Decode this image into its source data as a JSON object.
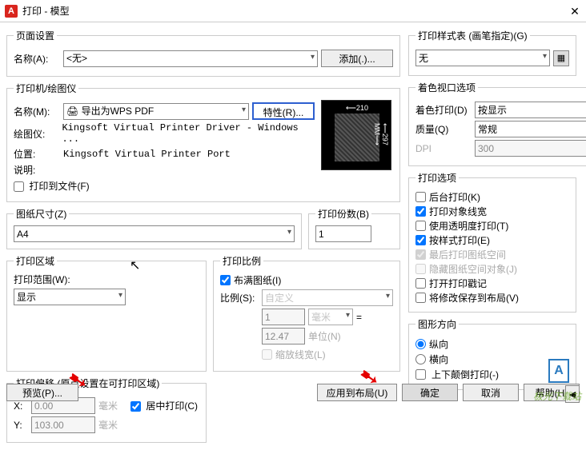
{
  "titlebar": {
    "logo": "A",
    "title": "打印 - 模型"
  },
  "pageSetup": {
    "legend": "页面设置",
    "nameLabel": "名称(A):",
    "nameValue": "<无>",
    "addBtn": "添加(.)..."
  },
  "printer": {
    "legend": "打印机/绘图仪",
    "nameLabel": "名称(M):",
    "nameValue": "导出为WPS PDF",
    "propsBtn": "特性(R)...",
    "plotterLabel": "绘图仪:",
    "plotterValue": "Kingsoft Virtual Printer Driver - Windows ...",
    "locationLabel": "位置:",
    "locationValue": "Kingsoft Virtual Printer Port",
    "descLabel": "说明:",
    "toFile": "打印到文件(F)",
    "dimTop": "⟵210 MM⟶",
    "dimRight": "⟵297 MM⟶"
  },
  "paper": {
    "legend": "图纸尺寸(Z)",
    "value": "A4"
  },
  "copies": {
    "legend": "打印份数(B)",
    "value": "1"
  },
  "area": {
    "legend": "打印区域",
    "rangeLabel": "打印范围(W):",
    "rangeValue": "显示"
  },
  "scale": {
    "legend": "打印比例",
    "fit": "布满图纸(I)",
    "ratioLabel": "比例(S):",
    "ratioValue": "自定义",
    "num": "1",
    "unit1": "毫米",
    "eq": "=",
    "den": "12.47",
    "unit2": "单位(N)",
    "lineweights": "缩放线宽(L)"
  },
  "offset": {
    "legend": "打印偏移 (原点设置在可打印区域)",
    "xLabel": "X:",
    "xVal": "0.00",
    "xUnit": "毫米",
    "yLabel": "Y:",
    "yVal": "103.00",
    "yUnit": "毫米",
    "center": "居中打印(C)"
  },
  "styleTable": {
    "legend": "打印样式表 (画笔指定)(G)",
    "value": "无"
  },
  "shaded": {
    "legend": "着色视口选项",
    "shadeLabel": "着色打印(D)",
    "shadeValue": "按显示",
    "qualityLabel": "质量(Q)",
    "qualityValue": "常规",
    "dpiLabel": "DPI",
    "dpiValue": "300"
  },
  "options": {
    "legend": "打印选项",
    "items": [
      {
        "label": "后台打印(K)",
        "checked": false,
        "disabled": false
      },
      {
        "label": "打印对象线宽",
        "checked": true,
        "disabled": false
      },
      {
        "label": "使用透明度打印(T)",
        "checked": false,
        "disabled": false
      },
      {
        "label": "按样式打印(E)",
        "checked": true,
        "disabled": false
      },
      {
        "label": "最后打印图纸空间",
        "checked": true,
        "disabled": true
      },
      {
        "label": "隐藏图纸空间对象(J)",
        "checked": false,
        "disabled": true
      },
      {
        "label": "打开打印戳记",
        "checked": false,
        "disabled": false
      },
      {
        "label": "将修改保存到布局(V)",
        "checked": false,
        "disabled": false
      }
    ]
  },
  "orient": {
    "legend": "图形方向",
    "portrait": "纵向",
    "landscape": "横向",
    "upside": "上下颠倒打印(-)",
    "iconLetter": "A"
  },
  "buttons": {
    "preview": "预览(P)...",
    "applyLayout": "应用到布局(U)",
    "ok": "确定",
    "cancel": "取消",
    "help": "帮助(H)"
  },
  "watermark": "极光下载站"
}
